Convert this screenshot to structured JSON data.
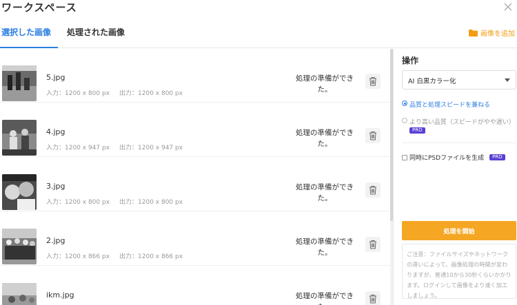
{
  "header": {
    "title": "ワークスペース"
  },
  "tabs": [
    {
      "label": "選択した画像",
      "active": true
    },
    {
      "label": "処理された画像",
      "active": false
    }
  ],
  "toolbar": {
    "add_images_label": "画像を追加"
  },
  "files": [
    {
      "name": "5.jpg",
      "input": "入力：1200 x 800 px",
      "output": "出力：1200 x 800 px",
      "status": "処理の準備ができた。"
    },
    {
      "name": "4.jpg",
      "input": "入力：1200 x 947 px",
      "output": "出力：1200 x 947 px",
      "status": "処理の準備ができた。"
    },
    {
      "name": "3.jpg",
      "input": "入力：1200 x 800 px",
      "output": "出力：1200 x 800 px",
      "status": "処理の準備ができた。"
    },
    {
      "name": "2.jpg",
      "input": "入力：1200 x 866 px",
      "output": "出力：1200 x 866 px",
      "status": "処理の準備ができた。"
    },
    {
      "name": "ikm.jpg",
      "input": "",
      "output": "",
      "status": "処理の準備ができた。"
    }
  ],
  "panel": {
    "title": "操作",
    "select_value": "AI 白黒カラー化",
    "option_balanced": "品質と処理スピードを兼ねる",
    "option_quality": "より高い品質（スピードがやや遅い）",
    "pro_badge": "PRO",
    "psd_label": "同時にPSDファイルを生成",
    "start_label": "処理を開始",
    "notice": "ご注意：ファイルサイズやネットワークの違いによって、画像処理の時間が変わりますが、普通10から30秒くらいかかります。ログインして画像をより速く加工しましょう。"
  },
  "colors": {
    "accent_blue": "#2b7de1",
    "accent_orange": "#f5a623",
    "pro_purple": "#5b3fd4"
  }
}
